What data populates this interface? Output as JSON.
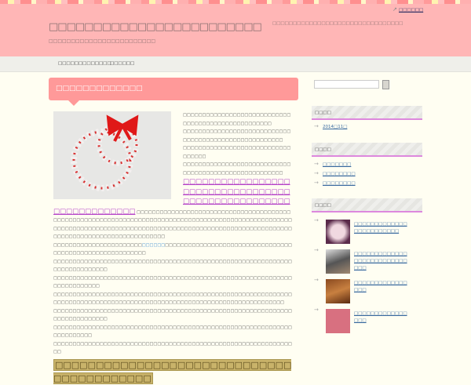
{
  "header": {
    "title": "□□□□□□□□□□□□□□□□□□□□□□□□",
    "description": "□□□□□□□□□□□□□□□□□□□□□□□□",
    "note": "□□□□□□□□□□□□□□□□□□□□□□□□□□□□□□□□",
    "top_link": "□□□□□□"
  },
  "nav": {
    "items": [
      "□□□□□□□□□□□□□",
      "□□□□□□"
    ]
  },
  "post": {
    "title": "□□□□□□□□□□□□□",
    "p1": "□□□□□□□□□□□□□□□□□□□□□□□□□□□□□□□□□□□□□□□□□□□□□□□□□□□",
    "p2": "□□□□□□□□□□□□□□□□□□□□□□□□□□□□□□□□□□□□□□□□□□□□□□□□□□□□□□",
    "p3": "□□□□□□□□□□□□□□□□□□□□□□□□□□□□□□□□□□",
    "p4": "□□□□□□□□□□□□□□□□□□□□□□□□□□□□□□□□□□□□□□□□□□□□□□□□□□□□□□",
    "big_link": "□□□□□□□□□□□□□□□□□□□□□□□□□□□□□□□□□□□□□□□□□□□□□□□□□□□□□□□□□□□□□□□□",
    "p5": "□□□□□□□□□□□□□□□□□□□□□□□□□□□□□□□□□□□□□□□□□□□□□□□□□□□□□□□□□□□□□□□□□□□□□□□□□□□□□□□□□□□□□□□□□□□□□□□□□□□□□□□□□□□□□□□□□□□□□□□□□□□□□□□□□□□□□□□□□□□□□□□□□□□□□□□□□□□□□□□□□□□□□□□□□□□□□□□□□□□□□□□□□□□□□□□□□",
    "p6a": "□□□□□□□□□□□□□□□□□□□□□□□",
    "p6_link": "□□□□□□",
    "p6b": "□□□□□□□□□□□□□□□□□□□□□□□□□□□□□□□□□□□□□□□□□□□□□□□□□□□□□□□□□",
    "p7": "□□□□□□□□□□□□□□□□□□□□□□□□□□□□□□□□□□□□□□□□□□□□□□□□□□□□□□□□□□□□□□□□□□□□□□□□□□□□",
    "p8": "□□□□□□□□□□□□□□□□□□□□□□□□□□□□□□□□□□□□□□□□□□□□□□□□□□□□□□□□□□□□□□□□□□□□□□□□□□",
    "p9": "□□□□□□□□□□□□□□□□□□□□□□□□□□□□□□□□□□□□□□□□□□□□□□□□□□□□□□□□□□□□□□□□□□□□□□□□□□□□□□□□□□□□□□□□□□□□□□□□□□□□□□□□□□□□□□□□□□□□□□□□□□",
    "p10": "□□□□□□□□□□□□□□□□□□□□□□□□□□□□□□□□□□□□□□□□□□□□□□□□□□□□□□□□□□□□□□□□□□□□□□□□□□□□",
    "p11": "□□□□□□□□□□□□□□□□□□□□□□□□□□□□□□□□□□□□□□□□□□□□□□□□□□□□□□□□□□□□□□□□□□□□□□□□",
    "p12": "□□□□□□□□□□□□□□□□□□□□□□□□□□□□□□□□□□□□□□□□□□□□□□□□□□□□□□□□□□□□□□□□",
    "highlight": "□□□□□□□□□□□□□□□□□□□□□□□□□□□□□□□□□□□□□□□□□"
  },
  "sidebar": {
    "archive": {
      "title": "□□□□",
      "items": [
        "2014□11□"
      ]
    },
    "categories": {
      "title": "□□□□",
      "items": [
        "□□□□□□□",
        "□□□□□□□□",
        "□□□□□□□□"
      ]
    },
    "recent": {
      "title": "□□□□",
      "items": [
        "□□□□□□□□□□□□□□□□□□□□□□□□",
        "□□□□□□□□□□□□□□□□□□□□□□□□□□□□□",
        "□□□□□□□□□□□□□□□□",
        "□□□□□□□□□□□□□□□□"
      ]
    }
  }
}
